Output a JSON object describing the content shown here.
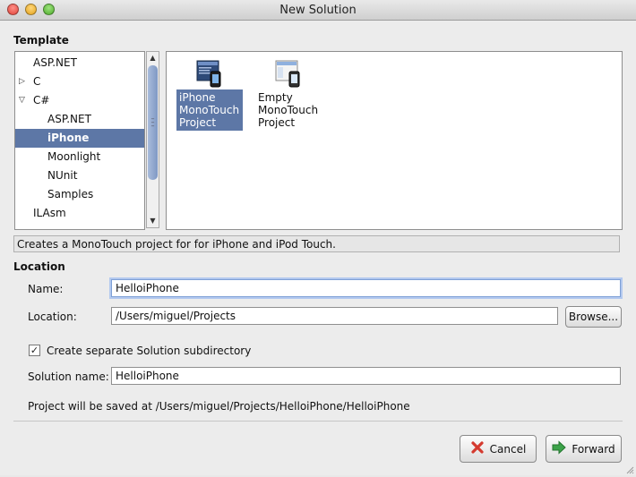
{
  "window": {
    "title": "New Solution"
  },
  "template": {
    "heading": "Template",
    "tree": [
      {
        "label": "ASP.NET",
        "arrow": ""
      },
      {
        "label": "C",
        "arrow": "▷"
      },
      {
        "label": "C#",
        "arrow": "▽"
      },
      {
        "label": "ASP.NET",
        "arrow": ""
      },
      {
        "label": "iPhone",
        "arrow": "",
        "selected": true
      },
      {
        "label": "Moonlight",
        "arrow": ""
      },
      {
        "label": "NUnit",
        "arrow": ""
      },
      {
        "label": "Samples",
        "arrow": ""
      },
      {
        "label": "ILAsm",
        "arrow": ""
      }
    ],
    "items": [
      {
        "caption": "iPhone\nMonoTouch\nProject",
        "icon": "iphone-project-icon",
        "selected": true
      },
      {
        "caption": "Empty\nMonoTouch\nProject",
        "icon": "empty-project-icon",
        "selected": false
      }
    ],
    "description": "Creates a MonoTouch project for for iPhone and iPod Touch."
  },
  "location": {
    "heading": "Location",
    "name_label": "Name:",
    "name_value": "HelloiPhone",
    "location_label": "Location:",
    "location_value": "/Users/miguel/Projects",
    "browse_label": "Browse...",
    "checkbox_label": "Create separate Solution subdirectory",
    "checkbox_checked": true,
    "checkbox_mark": "✓",
    "solution_label": "Solution name:",
    "solution_value": "HelloiPhone",
    "save_path": "Project will be saved at /Users/miguel/Projects/HelloiPhone/HelloiPhone"
  },
  "buttons": {
    "cancel_label": "Cancel",
    "forward_label": "Forward",
    "cancel_icon": "cancel-x-icon",
    "forward_icon": "forward-arrow-icon"
  },
  "colors": {
    "selection": "#5d77a6",
    "cancel_icon": "#d43a2f",
    "forward_icon": "#3ca34a"
  }
}
